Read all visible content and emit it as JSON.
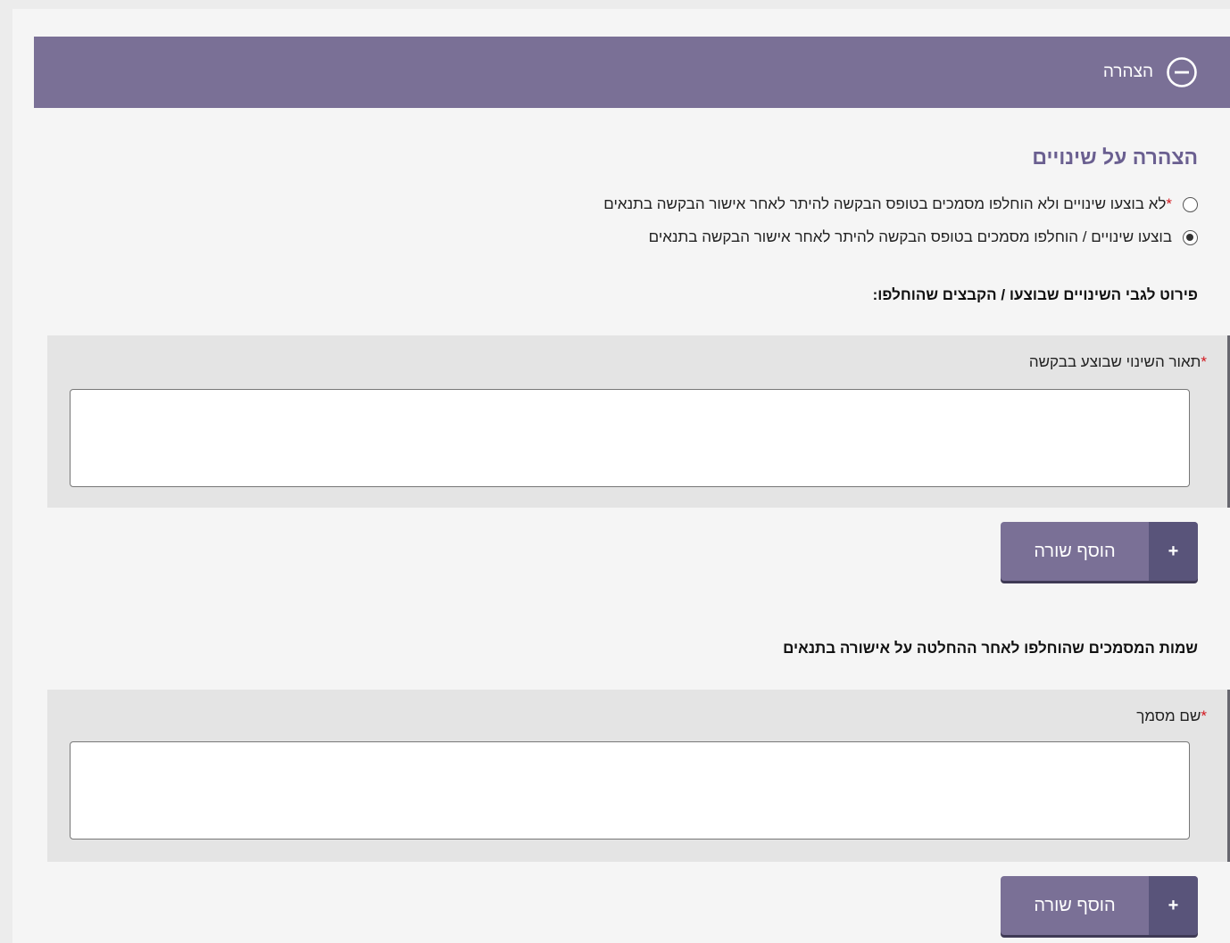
{
  "panel": {
    "title": "הצהרה",
    "collapse_icon": "minus-circle-icon",
    "header_color": "#7a7096"
  },
  "section": {
    "heading": "הצהרה על שינויים",
    "required_mark": "*",
    "options": [
      {
        "label": "לא בוצעו שינויים ולא הוחלפו מסמכים בטופס הבקשה להיתר לאחר אישור הבקשה בתנאים",
        "required": true,
        "selected": false
      },
      {
        "label": "בוצעו שינויים / הוחלפו מסמכים בטופס הבקשה להיתר לאחר אישור הבקשה בתנאים",
        "required": false,
        "selected": true
      }
    ]
  },
  "changes": {
    "heading": "פירוט לגבי השינויים שבוצעו / הקבצים שהוחלפו:",
    "field_label": "תאור השינוי שבוצע בבקשה",
    "field_value": "",
    "add_button": {
      "icon": "plus-icon",
      "icon_glyph": "+",
      "label": "הוסף שורה"
    }
  },
  "documents": {
    "heading": "שמות המסמכים שהוחלפו לאחר ההחלטה על אישורה בתנאים",
    "field_label": "שם מסמך",
    "field_value": "",
    "add_button": {
      "icon": "plus-icon",
      "icon_glyph": "+",
      "label": "הוסף שורה"
    }
  },
  "colors": {
    "accent": "#7a7096",
    "accent_dark": "#59547a",
    "heading": "#6a5f90",
    "required": "#d2161e"
  }
}
